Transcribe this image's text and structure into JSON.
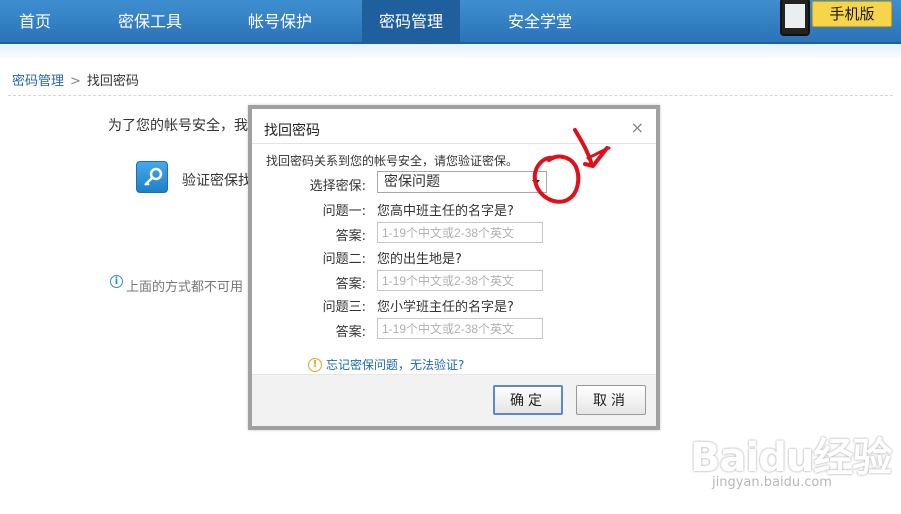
{
  "nav": {
    "items": [
      "首页",
      "密保工具",
      "帐号保护",
      "密码管理",
      "安全学堂"
    ],
    "active_index": 3,
    "promo_label": "手机版"
  },
  "breadcrumb": {
    "parent": "密码管理",
    "separator": ">",
    "current": "找回密码"
  },
  "background": {
    "intro": "为了您的帐号安全，我",
    "option_label": "验证密保找",
    "hint": "上面的方式都不可用"
  },
  "dialog": {
    "title": "找回密码",
    "close": "×",
    "intro": "找回密码关系到您的帐号安全，请您验证密保。",
    "select_label": "选择密保:",
    "select_value": "密保问题",
    "questions": [
      {
        "label": "问题一:",
        "text": "您高中班主任的名字是?",
        "answer_label": "答案:",
        "placeholder": "1-19个中文或2-38个英文"
      },
      {
        "label": "问题二:",
        "text": "您的出生地是?",
        "answer_label": "答案:",
        "placeholder": "1-19个中文或2-38个英文"
      },
      {
        "label": "问题三:",
        "text": "您小学班主任的名字是?",
        "answer_label": "答案:",
        "placeholder": "1-19个中文或2-38个英文"
      }
    ],
    "forgot_link": "忘记密保问题，无法验证?",
    "ok_label": "确定",
    "cancel_label": "取消"
  },
  "watermark": {
    "main": "Baidu经验",
    "sub": "jingyan.baidu.com"
  },
  "colors": {
    "nav_bg": "#2a73b8",
    "nav_active": "#1f5f9e",
    "link": "#1c6ab2",
    "annotation": "#e0101a"
  }
}
